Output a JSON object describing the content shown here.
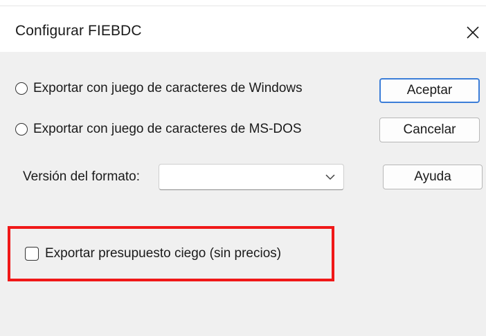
{
  "dialog": {
    "title": "Configurar FIEBDC",
    "close_icon": "close-icon"
  },
  "options": {
    "windows_charset_label": "Exportar con juego de caracteres de Windows",
    "windows_charset_selected": false,
    "msdos_charset_label": "Exportar con juego de caracteres de MS-DOS",
    "msdos_charset_selected": false
  },
  "buttons": {
    "accept_label": "Aceptar",
    "cancel_label": "Cancelar",
    "help_label": "Ayuda"
  },
  "format_version": {
    "label": "Versión del formato:",
    "selected_value": ""
  },
  "blind_budget": {
    "label": "Exportar presupuesto ciego (sin precios)",
    "checked": false
  },
  "colors": {
    "highlight": "#f01818",
    "default_button_border": "#3b7dd8",
    "background": "#f0f0f0"
  }
}
